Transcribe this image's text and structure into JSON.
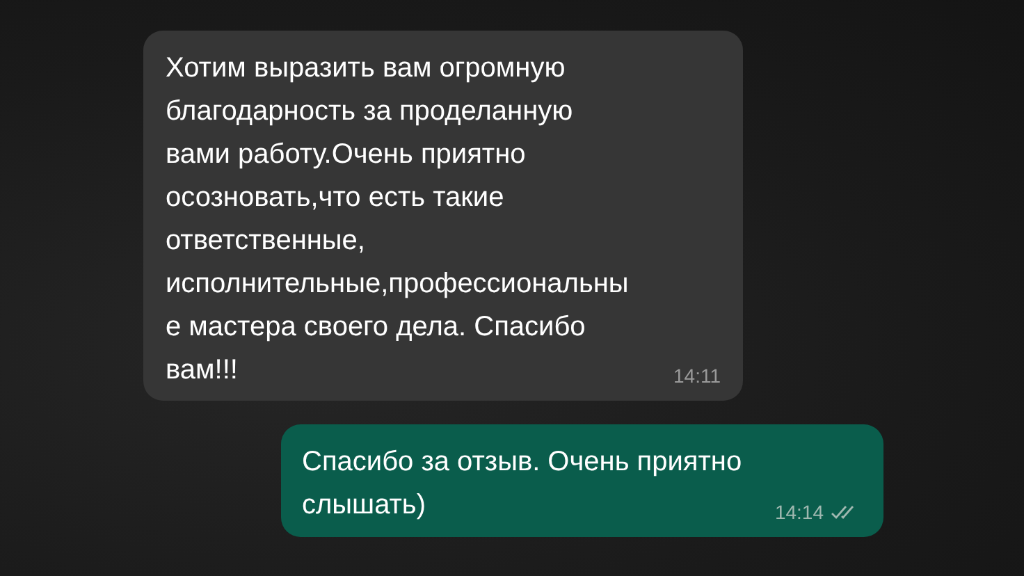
{
  "messages": [
    {
      "kind": "incoming",
      "lines": [
        "Хотим выразить вам огромную",
        "благодарность за проделанную",
        "вами работу.Очень приятно",
        "осозновать,что есть такие",
        "ответственные,",
        "исполнительные,профессиональны",
        "е мастера своего дела. Спасибо",
        "вам!!!"
      ],
      "time": "14:11"
    },
    {
      "kind": "outgoing",
      "lines": [
        "Спасибо за отзыв. Очень приятно",
        "слышать)"
      ],
      "time": "14:14",
      "read": false
    }
  ]
}
